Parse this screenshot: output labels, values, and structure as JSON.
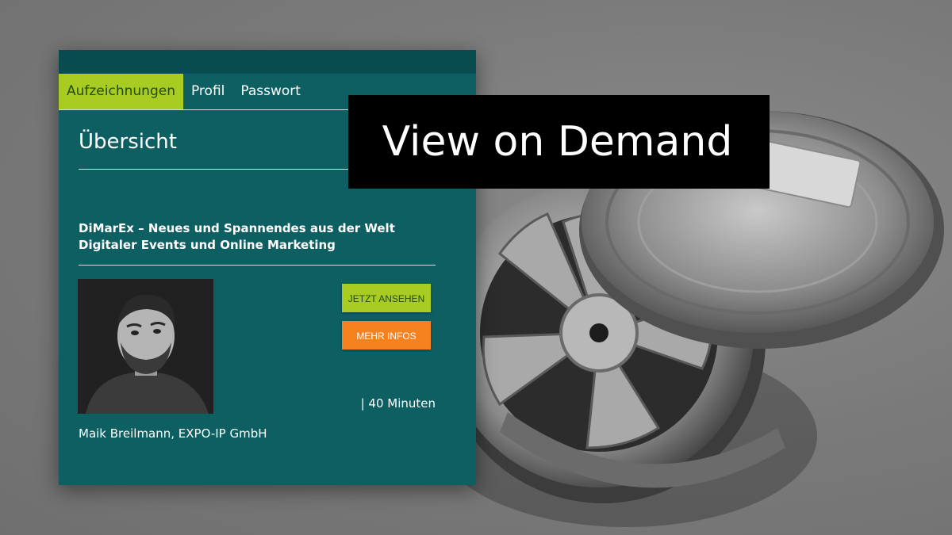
{
  "tabs": [
    {
      "label": "Aufzeichnungen",
      "active": true
    },
    {
      "label": "Profil",
      "active": false
    },
    {
      "label": "Passwort",
      "active": false
    }
  ],
  "page": {
    "title": "Übersicht"
  },
  "event": {
    "title": "DiMarEx – Neues und Spannendes aus der Welt Digitaler Events und Online Marketing",
    "watch_button": "JETZT ANSEHEN",
    "info_button": "MEHR INFOS",
    "duration": "| 40 Minuten",
    "speaker": "Maik Breilmann, EXPO-IP GmbH"
  },
  "overlay": {
    "title": "View on Demand"
  },
  "colors": {
    "card_bg": "#0e5f62",
    "card_topbar": "#094c50",
    "active_tab": "#a8cc22",
    "watch_button": "#a8cc22",
    "info_button": "#f5811f",
    "overlay_bg": "#000000"
  },
  "icons": {
    "background": "film-reel-image",
    "photo": "speaker-portrait"
  }
}
